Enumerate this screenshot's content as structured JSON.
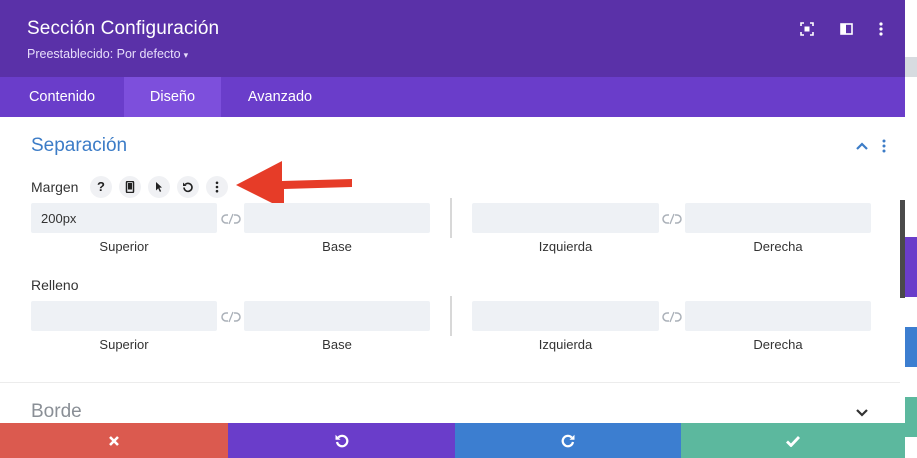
{
  "header": {
    "title": "Sección Configuración",
    "preset": "Preestablecido: Por defecto",
    "preset_caret": "▾",
    "icons": [
      "fullscreen-icon",
      "sidebar-toggle-icon",
      "more-options-icon"
    ]
  },
  "tabs": [
    {
      "label": "Contenido",
      "active": false
    },
    {
      "label": "Diseño",
      "active": true
    },
    {
      "label": "Avanzado",
      "active": false
    }
  ],
  "section": {
    "title": "Separación",
    "margin": {
      "label": "Margen",
      "tools": [
        "help-icon",
        "responsive-icon",
        "hover-state-icon",
        "reset-icon",
        "more-options-icon"
      ],
      "help_glyph": "?",
      "fields": [
        {
          "label": "Superior",
          "value": "200px"
        },
        {
          "label": "Base",
          "value": ""
        },
        {
          "label": "Izquierda",
          "value": ""
        },
        {
          "label": "Derecha",
          "value": ""
        }
      ]
    },
    "padding": {
      "label": "Relleno",
      "fields": [
        {
          "label": "Superior",
          "value": ""
        },
        {
          "label": "Base",
          "value": ""
        },
        {
          "label": "Izquierda",
          "value": ""
        },
        {
          "label": "Derecha",
          "value": ""
        }
      ]
    }
  },
  "section2": {
    "title": "Borde"
  },
  "footer": {
    "buttons": [
      {
        "name": "discard",
        "icon": "close-icon",
        "color": "#db5a4f"
      },
      {
        "name": "undo",
        "icon": "undo-icon",
        "color": "#6a3dca"
      },
      {
        "name": "redo",
        "icon": "redo-icon",
        "color": "#3c7ed0"
      },
      {
        "name": "save",
        "icon": "checkmark-icon",
        "color": "#5cb89e"
      }
    ]
  },
  "annotation": {
    "arrow_color": "#e63c28"
  },
  "colors": {
    "header_bg": "#5a31a8",
    "tabs_bg": "#6a3dca",
    "tab_active_bg": "#7d4fdc",
    "section_title": "#3c7cc7"
  }
}
